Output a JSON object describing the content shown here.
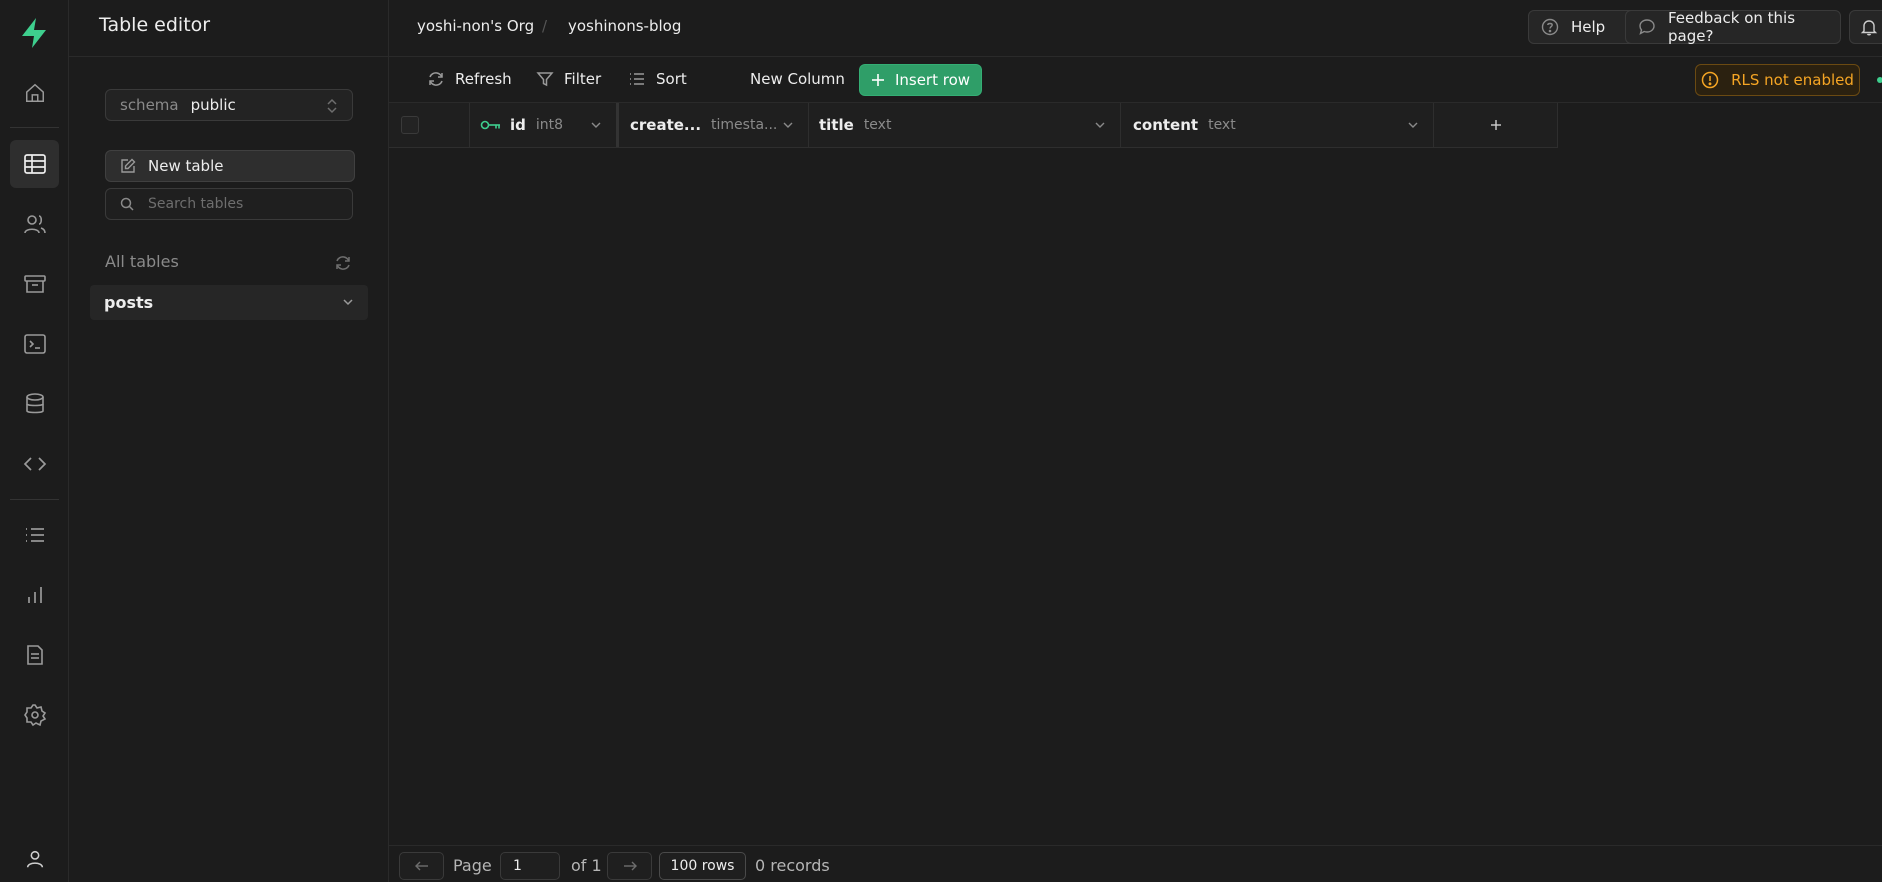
{
  "rail": {
    "items": [
      "home-icon",
      "table-editor-icon",
      "auth-users-icon",
      "storage-icon",
      "sql-editor-icon",
      "database-icon",
      "api-icon",
      "logs-icon",
      "reports-icon",
      "docs-icon",
      "settings-icon",
      "account-icon"
    ]
  },
  "panel": {
    "title": "Table editor",
    "schema_label": "schema",
    "schema_value": "public",
    "new_table_label": "New table",
    "search_placeholder": "Search tables",
    "all_tables_label": "All tables",
    "tables": [
      "posts"
    ]
  },
  "header": {
    "org": "yoshi-non's Org",
    "separator": "/",
    "project": "yoshinons-blog",
    "help_label": "Help",
    "feedback_label": "Feedback on this page?"
  },
  "toolbar": {
    "refresh_label": "Refresh",
    "filter_label": "Filter",
    "sort_label": "Sort",
    "new_column_label": "New Column",
    "insert_row_label": "Insert row",
    "rls_label": "RLS not enabled"
  },
  "columns": [
    {
      "name": "id",
      "type": "int8"
    },
    {
      "name": "create...",
      "type": "timesta..."
    },
    {
      "name": "title",
      "type": "text"
    },
    {
      "name": "content",
      "type": "text"
    }
  ],
  "footer": {
    "page_label": "Page",
    "page_value": "1",
    "of_label": "of 1",
    "rows_label": "100 rows",
    "records_label": "0 records"
  },
  "colors": {
    "brand": "#3ecf8e",
    "insert_button": "#2f9e68",
    "warning": "#f5a524",
    "background": "#1c1c1c"
  }
}
